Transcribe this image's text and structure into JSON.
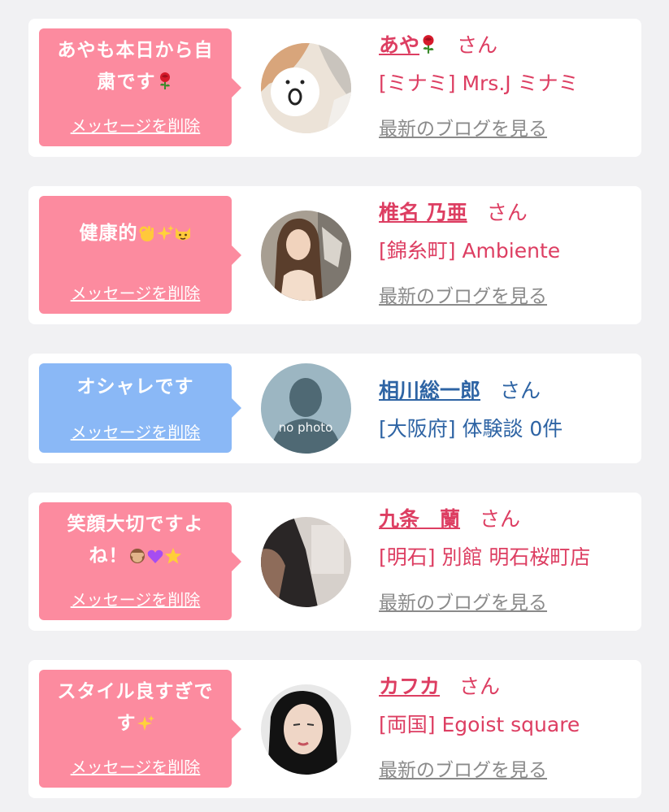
{
  "delete_label": "メッセージを削除",
  "colors": {
    "pink_bubble": "#fc8b9f",
    "blue_bubble": "#8ab8f6",
    "pink_text": "#dd3e62",
    "blue_text": "#2e64a4"
  },
  "items": [
    {
      "message_line1": "あやも本日から自",
      "message_line2": "粛です",
      "message_emoji": "rose",
      "name": "あや",
      "name_emoji": "rose",
      "san": "さん",
      "shop": "[ミナミ] Mrs.J ミナミ",
      "blog": "最新のブログを見る",
      "avatar": "face-sticker-photo"
    },
    {
      "message_line1": "健康的",
      "message_emoji": "ok-hand sparkles cat",
      "name": "椎名 乃亜",
      "san": "さん",
      "shop": "[錦糸町] Ambiente",
      "blog": "最新のブログを見る",
      "avatar": "woman-photo"
    },
    {
      "message_line1": "オシャレです",
      "name": "相川総一郎",
      "san": "さん",
      "shop": "[大阪府] 体験談 0件",
      "avatar": "no-photo-silhouette",
      "no_photo": "no photo"
    },
    {
      "message_line1": "笑顔大切ですよ",
      "message_line2": "ね！",
      "message_emoji": "see-no-evil purple-heart star",
      "name": "九条　蘭",
      "san": "さん",
      "shop": "[明石] 別館 明石桜町店",
      "blog": "最新のブログを見る",
      "avatar": "dark-photo"
    },
    {
      "message_line1": "スタイル良すぎで",
      "message_line2": "す",
      "message_emoji": "sparkles",
      "name": "カフカ",
      "san": "さん",
      "shop": "[両国] Egoist square",
      "blog": "最新のブログを見る",
      "avatar": "woman-selfie-photo"
    }
  ]
}
